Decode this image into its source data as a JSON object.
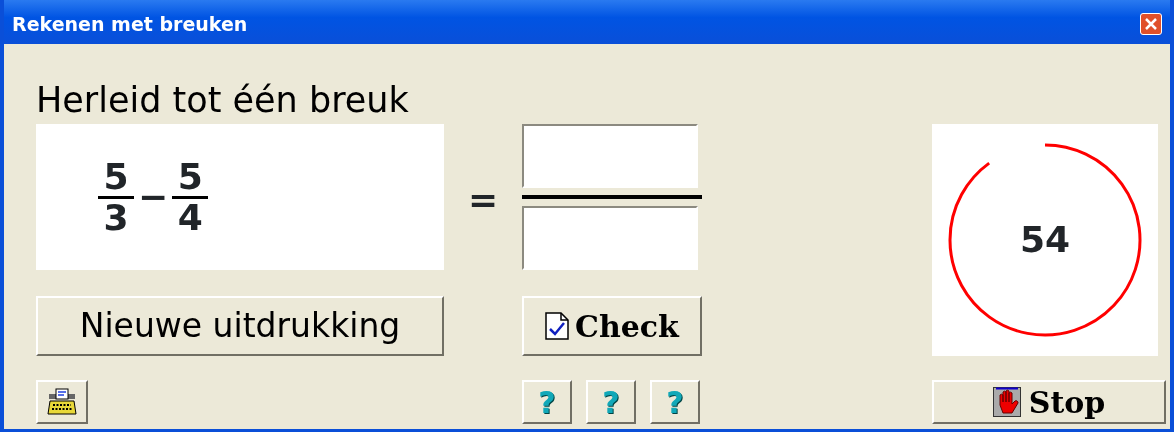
{
  "window": {
    "title": "Rekenen met breuken"
  },
  "heading": "Herleid tot één breuk",
  "expression": {
    "terms": [
      {
        "numerator": "5",
        "denominator": "3"
      },
      {
        "numerator": "5",
        "denominator": "4"
      }
    ],
    "operators": [
      "−"
    ]
  },
  "equals": "=",
  "new_button": "Nieuwe uitdrukking",
  "check_button": "Check",
  "help_buttons": [
    "?",
    "?",
    "?"
  ],
  "timer": {
    "value": "54",
    "level": 0.9
  },
  "stop_button": "Stop"
}
